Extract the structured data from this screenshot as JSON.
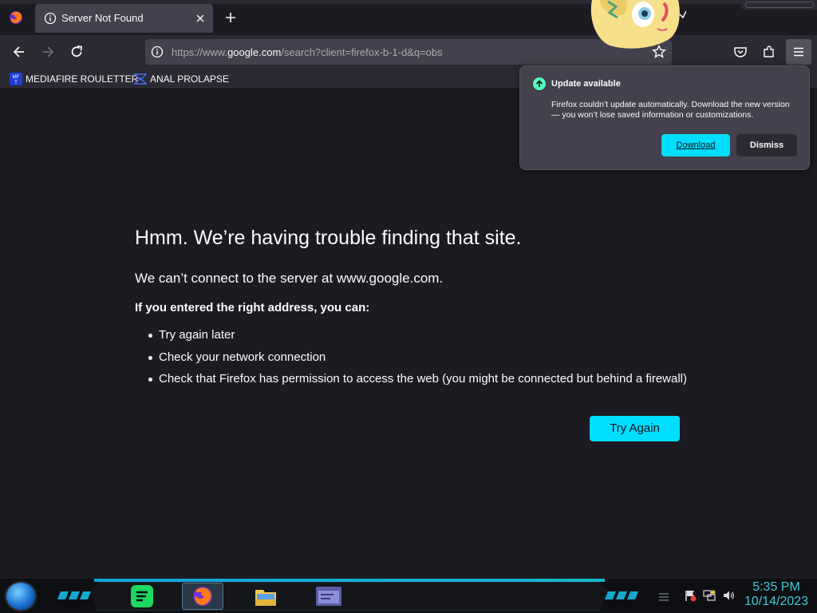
{
  "browser": {
    "tab": {
      "title": "Server Not Found"
    },
    "url": {
      "prefix": "https://www.",
      "host": "google.com",
      "path": "/search?client=firefox-b-1-d&q=obs"
    },
    "bookmarks": [
      {
        "label": "MEDIAFIRE ROULETTER",
        "icon": "mediafire-icon"
      },
      {
        "label": "ANAL PROLAPSE",
        "icon": "bookmark-folder-icon"
      }
    ]
  },
  "error_page": {
    "title": "Hmm. We’re having trouble finding that site.",
    "subtitle": "We can’t connect to the server at www.google.com.",
    "lead": "If you entered the right address, you can:",
    "suggestions": [
      "Try again later",
      "Check your network connection",
      "Check that Firefox has permission to access the web (you might be connected but behind a firewall)"
    ],
    "try_again_label": "Try Again"
  },
  "update_popup": {
    "title": "Update available",
    "message": "Firefox couldn’t update automatically. Download the new version — you won’t lose saved information or customizations.",
    "download_label": "Download",
    "dismiss_label": "Dismiss"
  },
  "taskbar": {
    "apps": [
      "spotify-icon",
      "firefox-icon",
      "file-explorer-icon",
      "window-app-icon"
    ],
    "clock_time": "5:35 PM",
    "clock_date": "10/14/2023"
  },
  "colors": {
    "accent": "#00ddff",
    "page_bg": "#1c1b22",
    "toolbar_bg": "#2b2a33",
    "clock": "#3fc9d8"
  }
}
